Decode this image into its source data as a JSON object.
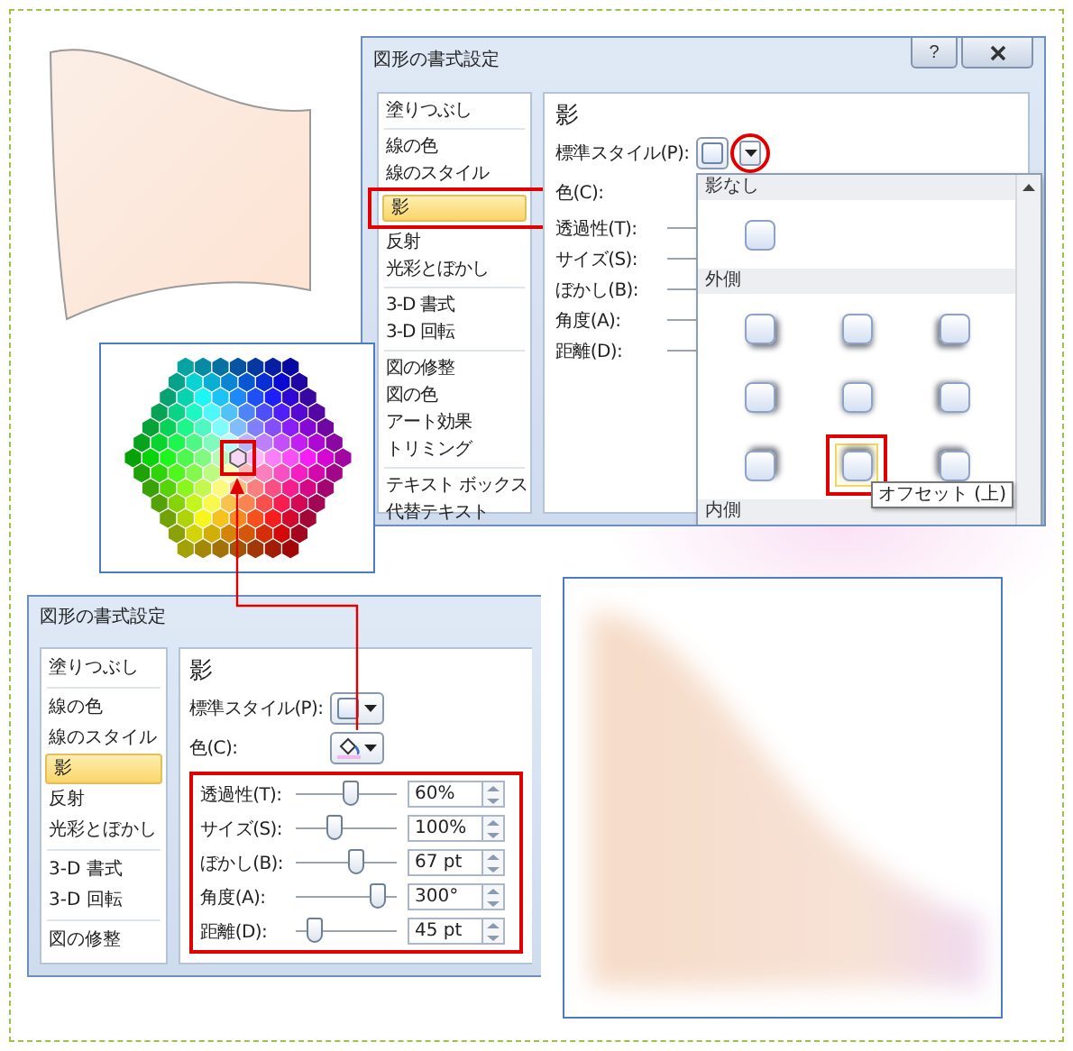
{
  "top_dialog": {
    "title": "図形の書式設定",
    "help": "?",
    "sidebar": [
      {
        "items": [
          {
            "label": "塗りつぶし",
            "selected": false
          }
        ]
      },
      {
        "items": [
          {
            "label": "線の色",
            "selected": false
          },
          {
            "label": "線のスタイル",
            "selected": false
          },
          {
            "label": "影",
            "selected": true
          },
          {
            "label": "反射",
            "selected": false
          },
          {
            "label": "光彩とぼかし",
            "selected": false
          }
        ]
      },
      {
        "items": [
          {
            "label": "3-D 書式",
            "selected": false
          },
          {
            "label": "3-D 回転",
            "selected": false
          }
        ]
      },
      {
        "items": [
          {
            "label": "図の修整",
            "selected": false
          },
          {
            "label": "図の色",
            "selected": false
          },
          {
            "label": "アート効果",
            "selected": false
          },
          {
            "label": "トリミング",
            "selected": false
          }
        ]
      },
      {
        "items": [
          {
            "label": "テキスト ボックス",
            "selected": false
          },
          {
            "label": "代替テキスト",
            "selected": false
          }
        ]
      }
    ],
    "heading": "影",
    "style_label": "標準スタイル(P):",
    "color_label": "色(C):",
    "sliders": [
      {
        "label": "透過性(T):"
      },
      {
        "label": "サイズ(S):"
      },
      {
        "label": "ぼかし(B):"
      },
      {
        "label": "角度(A):"
      },
      {
        "label": "距離(D):"
      }
    ],
    "style_gallery": {
      "sections": [
        {
          "kind": "none",
          "label": "影なし",
          "tiles": [
            {
              "selected": false
            }
          ]
        },
        {
          "kind": "outer",
          "label": "外側",
          "tiles": [
            {
              "selected": false
            },
            {
              "selected": false
            },
            {
              "selected": false
            },
            {
              "selected": false
            },
            {
              "selected": false
            },
            {
              "selected": false
            },
            {
              "selected": false
            },
            {
              "selected": true
            },
            {
              "selected": false
            }
          ]
        },
        {
          "kind": "inner",
          "label": "内側"
        }
      ],
      "tooltip": "オフセット (上)"
    }
  },
  "bottom_dialog": {
    "title": "図形の書式設定",
    "sidebar": [
      {
        "items": [
          {
            "label": "塗りつぶし",
            "selected": false
          }
        ]
      },
      {
        "items": [
          {
            "label": "線の色",
            "selected": false
          },
          {
            "label": "線のスタイル",
            "selected": false
          },
          {
            "label": "影",
            "selected": true
          },
          {
            "label": "反射",
            "selected": false
          },
          {
            "label": "光彩とぼかし",
            "selected": false
          }
        ]
      },
      {
        "items": [
          {
            "label": "3-D 書式",
            "selected": false
          },
          {
            "label": "3-D 回転",
            "selected": false
          }
        ]
      },
      {
        "items": [
          {
            "label": "図の修整",
            "selected": false
          }
        ]
      }
    ],
    "heading": "影",
    "style_label": "標準スタイル(P):",
    "color_label": "色(C):",
    "sliders": [
      {
        "label": "透過性(T):",
        "level": 0.55,
        "value": "60%"
      },
      {
        "label": "サイズ(S):",
        "level": 0.4,
        "value": "100%"
      },
      {
        "label": "ぼかし(B):",
        "level": 0.6,
        "value": "67 pt"
      },
      {
        "label": "角度(A):",
        "level": 0.83,
        "value": "300°"
      },
      {
        "label": "距離(D):",
        "level": 0.2,
        "value": "45 pt"
      }
    ]
  }
}
